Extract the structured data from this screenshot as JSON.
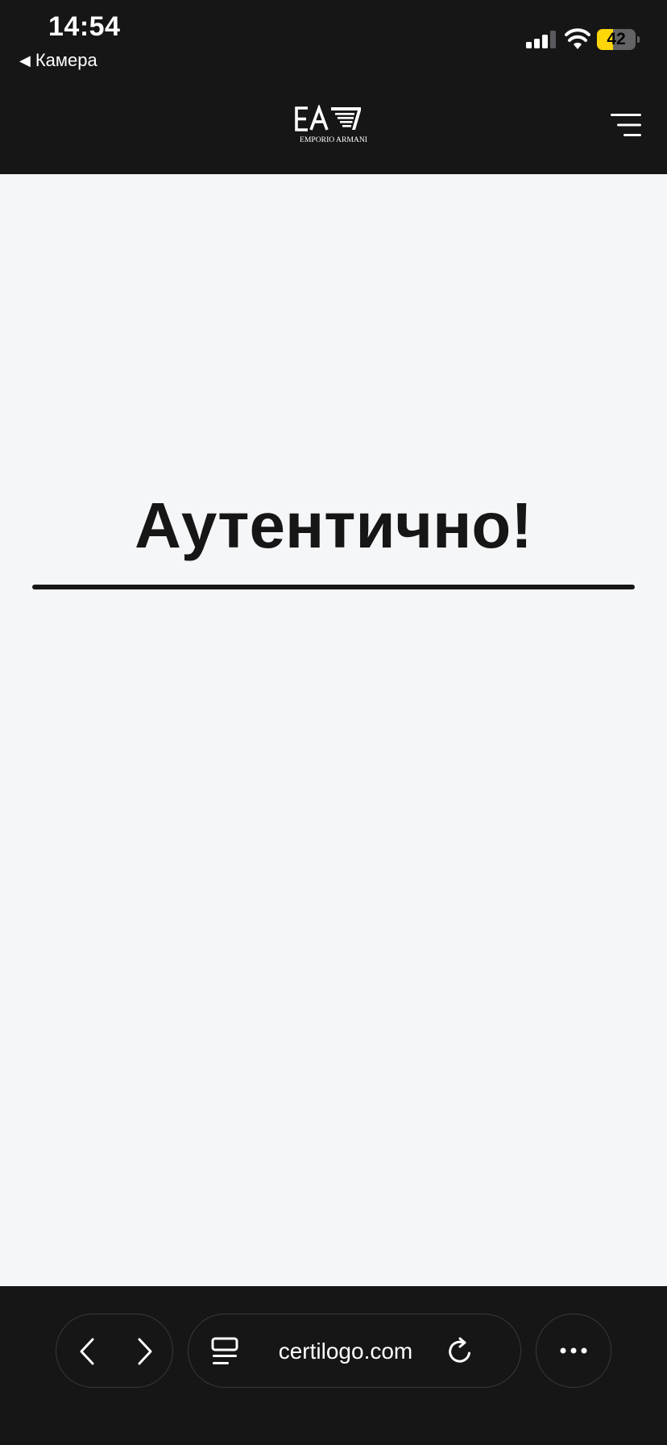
{
  "status_bar": {
    "time": "14:54",
    "back_app": "Камера",
    "battery_level": 42,
    "battery_label": "42",
    "battery_color": "#ffd60a"
  },
  "header": {
    "logo_text": "EA7",
    "logo_subtext": "EMPORIO ARMANI",
    "menu_icon": "hamburger-menu-icon"
  },
  "main": {
    "verdict": "Аутентично!"
  },
  "browser": {
    "url": "certilogo.com",
    "back_icon": "chevron-left-icon",
    "forward_icon": "chevron-right-icon",
    "reader_icon": "reader-mode-icon",
    "reload_icon": "reload-icon",
    "more_icon": "more-dots-icon"
  }
}
